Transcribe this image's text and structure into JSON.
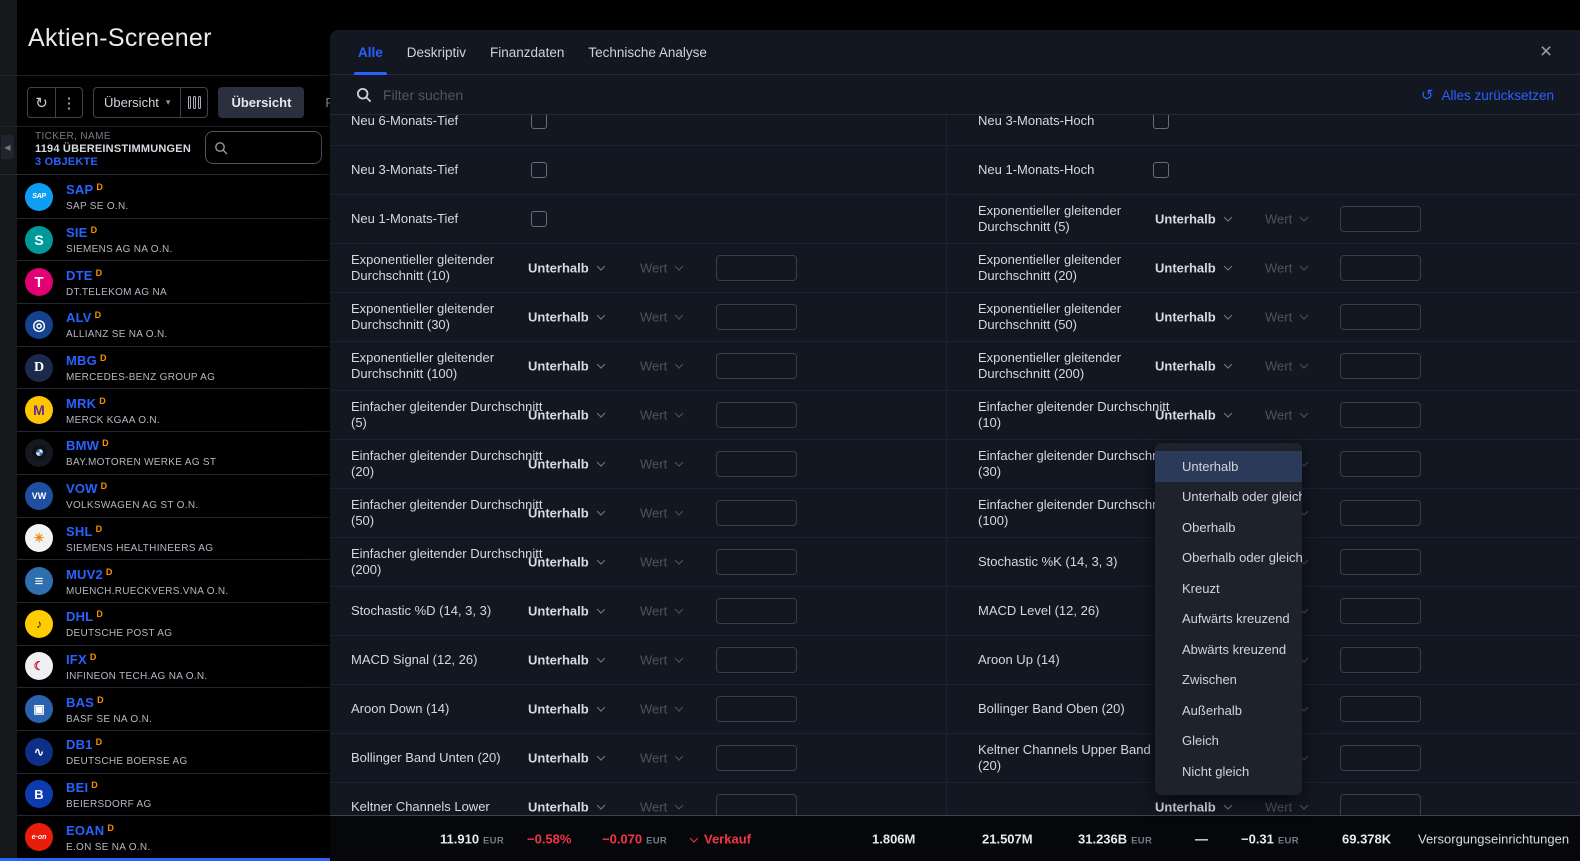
{
  "window": {
    "title": "Aktien-Screener",
    "close_icon": "×"
  },
  "toolbar": {
    "refresh_icon": "↻",
    "more_icon": "⋮",
    "view_select": {
      "label": "Übersicht",
      "caret": "▾"
    },
    "tabs": [
      {
        "label": "Übersicht",
        "active": true
      },
      {
        "label": "Performance",
        "active": false
      }
    ]
  },
  "sidebar": {
    "collapse_icon": "◀",
    "header": {
      "column_label": "TICKER, NAME",
      "matches": "1194 ÜBEREINSTIMMUNGEN",
      "objects": "3 OBJEKTE"
    },
    "stocks": [
      {
        "ticker": "SAP",
        "flag": "D",
        "name": "SAP SE O.N.",
        "logo": {
          "bg": "#0d9df2",
          "glyph": "SAP",
          "size": 7,
          "class": "logo-sap"
        }
      },
      {
        "ticker": "SIE",
        "flag": "D",
        "name": "SIEMENS AG NA O.N.",
        "logo": {
          "bg": "#009999",
          "glyph": "S",
          "size": 14
        }
      },
      {
        "ticker": "DTE",
        "flag": "D",
        "name": "DT.TELEKOM AG NA",
        "logo": {
          "bg": "#e20074",
          "glyph": "T",
          "size": 15
        }
      },
      {
        "ticker": "ALV",
        "flag": "D",
        "name": "ALLIANZ SE NA O.N.",
        "logo": {
          "bg": "#16418f",
          "glyph": "◎",
          "size": 15
        }
      },
      {
        "ticker": "MBG",
        "flag": "D",
        "name": "MERCEDES-BENZ GROUP AG",
        "logo": {
          "bg": "#1b2a4a",
          "glyph": "D",
          "size": 14,
          "class": "logo-serif"
        }
      },
      {
        "ticker": "MRK",
        "flag": "D",
        "name": "MERCK KGAA O.N.",
        "logo": {
          "bg": "#ffc600",
          "glyph": "M",
          "size": 14,
          "color": "#5b2e91"
        }
      },
      {
        "ticker": "BMW",
        "flag": "D",
        "name": "BAY.MOTOREN WERKE AG ST",
        "logo": {
          "bg": "#15181e",
          "glyph": "",
          "class": "logo-bmw"
        }
      },
      {
        "ticker": "VOW",
        "flag": "D",
        "name": "VOLKSWAGEN AG ST O.N.",
        "logo": {
          "bg": "#1e4fa1",
          "glyph": "VW",
          "size": 9
        }
      },
      {
        "ticker": "SHL",
        "flag": "D",
        "name": "SIEMENS HEALTHINEERS AG",
        "logo": {
          "bg": "#f2f3f5",
          "glyph": "✳",
          "size": 12,
          "color": "#f08300"
        }
      },
      {
        "ticker": "MUV2",
        "flag": "D",
        "name": "MUENCH.RUECKVERS.VNA O.N.",
        "logo": {
          "bg": "#2f6fad",
          "glyph": "≡",
          "size": 15
        }
      },
      {
        "ticker": "DHL",
        "flag": "D",
        "name": "DEUTSCHE POST AG",
        "logo": {
          "bg": "#ffcc00",
          "glyph": "♪",
          "size": 12,
          "color": "#2b2000"
        }
      },
      {
        "ticker": "IFX",
        "flag": "D",
        "name": "INFINEON TECH.AG NA O.N.",
        "logo": {
          "bg": "#eef0f3",
          "glyph": "☾",
          "size": 12,
          "color": "#cf0a2c"
        }
      },
      {
        "ticker": "BAS",
        "flag": "D",
        "name": "BASF SE NA O.N.",
        "logo": {
          "bg": "#2a63ad",
          "glyph": "▣",
          "size": 12
        }
      },
      {
        "ticker": "DB1",
        "flag": "D",
        "name": "DEUTSCHE BOERSE AG",
        "logo": {
          "bg": "#0d2f86",
          "glyph": "∿",
          "size": 12
        }
      },
      {
        "ticker": "BEI",
        "flag": "D",
        "name": "BEIERSDORF AG",
        "logo": {
          "bg": "#0c3bb0",
          "glyph": "B",
          "size": 13
        }
      },
      {
        "ticker": "EOAN",
        "flag": "D",
        "name": "E.ON SE NA O.N.",
        "logo": {
          "bg": "#ea1c0a",
          "glyph": "e·on",
          "size": 7,
          "class": "logo-eon"
        }
      }
    ]
  },
  "dialog": {
    "tabs": [
      {
        "label": "Alle",
        "active": true
      },
      {
        "label": "Deskriptiv",
        "active": false
      },
      {
        "label": "Finanzdaten",
        "active": false
      },
      {
        "label": "Technische Analyse",
        "active": false
      }
    ],
    "search_placeholder": "Filter suchen",
    "reset": {
      "icon": "↺",
      "label": "Alles zurücksetzen"
    },
    "operator_default": "Unterhalb",
    "value_default": "Wert",
    "left_rows": [
      {
        "label": "Neu 6-Monats-Tief",
        "control": "checkbox"
      },
      {
        "label": "Neu 3-Monats-Tief",
        "control": "checkbox"
      },
      {
        "label": "Neu 1-Monats-Tief",
        "control": "checkbox"
      },
      {
        "label": "Exponentieller gleitender Durchschnitt (10)",
        "control": "operator"
      },
      {
        "label": "Exponentieller gleitender Durchschnitt (30)",
        "control": "operator"
      },
      {
        "label": "Exponentieller gleitender Durchschnitt (100)",
        "control": "operator"
      },
      {
        "label": "Einfacher gleitender Durchschnitt (5)",
        "control": "operator"
      },
      {
        "label": "Einfacher gleitender Durchschnitt (20)",
        "control": "operator"
      },
      {
        "label": "Einfacher gleitender Durchschnitt (50)",
        "control": "operator"
      },
      {
        "label": "Einfacher gleitender Durchschnitt (200)",
        "control": "operator"
      },
      {
        "label": "Stochastic %D (14, 3, 3)",
        "control": "operator"
      },
      {
        "label": "MACD Signal (12, 26)",
        "control": "operator"
      },
      {
        "label": "Aroon Down (14)",
        "control": "operator"
      },
      {
        "label": "Bollinger Band Unten (20)",
        "control": "operator"
      },
      {
        "label": "Keltner Channels Lower",
        "control": "operator"
      }
    ],
    "right_rows": [
      {
        "label": "Neu 3-Monats-Hoch",
        "control": "checkbox"
      },
      {
        "label": "Neu 1-Monats-Hoch",
        "control": "checkbox"
      },
      {
        "label": "Exponentieller gleitender Durchschnitt (5)",
        "control": "operator"
      },
      {
        "label": "Exponentieller gleitender Durchschnitt (20)",
        "control": "operator"
      },
      {
        "label": "Exponentieller gleitender Durchschnitt (50)",
        "control": "operator"
      },
      {
        "label": "Exponentieller gleitender Durchschnitt (200)",
        "control": "operator"
      },
      {
        "label": "Einfacher gleitender Durchschnitt (10)",
        "control": "operator"
      },
      {
        "label": "Einfacher gleitender Durchschnitt (30)",
        "control": "operator"
      },
      {
        "label": "Einfacher gleitender Durchschnitt (100)",
        "control": "operator"
      },
      {
        "label": "Stochastic %K (14, 3, 3)",
        "control": "operator"
      },
      {
        "label": "MACD Level (12, 26)",
        "control": "operator"
      },
      {
        "label": "Aroon Up (14)",
        "control": "operator"
      },
      {
        "label": "Bollinger Band Oben (20)",
        "control": "operator"
      },
      {
        "label": "Keltner Channels Upper Band (20)",
        "control": "operator"
      },
      {
        "label": "",
        "control": "operator"
      }
    ]
  },
  "dropdown": {
    "selected": "Unterhalb",
    "options": [
      "Unterhalb",
      "Unterhalb oder gleich",
      "Oberhalb",
      "Oberhalb oder gleich",
      "Kreuzt",
      "Aufwärts kreuzend",
      "Abwärts kreuzend",
      "Zwischen",
      "Außerhalb",
      "Gleich",
      "Nicht gleich"
    ]
  },
  "statusbar": {
    "segments": [
      {
        "text": "11.910",
        "unit": "EUR"
      },
      {
        "text": "−0.58%",
        "color": "red"
      },
      {
        "text": "−0.070",
        "unit": "EUR",
        "color": "red"
      },
      {
        "text": "Verkauf",
        "color": "red",
        "chevron": true
      },
      {
        "text": "1.806M"
      },
      {
        "text": "21.507M"
      },
      {
        "text": "31.236B",
        "unit": "EUR"
      },
      {
        "text": "—"
      },
      {
        "text": "−0.31",
        "unit": "EUR"
      },
      {
        "text": "69.378K"
      },
      {
        "text": "Versorgungseinrichtungen",
        "plain": true
      }
    ]
  },
  "colors": {
    "accent": "#2962ff",
    "red": "#f23645",
    "panel_bg": "#131722",
    "menu_bg": "#1e222d",
    "text": "#d1d4dc",
    "muted": "#787b86",
    "flag_orange": "#f59100"
  }
}
